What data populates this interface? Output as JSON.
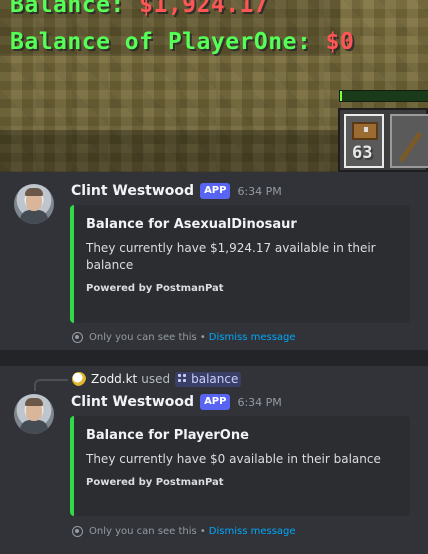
{
  "minecraft": {
    "lines": [
      {
        "label": "Balance: ",
        "amount": "$1,924.17"
      },
      {
        "label": "Balance of PlayerOne: ",
        "amount": "$0"
      }
    ],
    "hotbar": {
      "slot1_count": "63"
    },
    "xp_level_fraction": 0.02,
    "colors": {
      "label": "#55ff55",
      "amount": "#ff5555"
    }
  },
  "messages": [
    {
      "author": "Clint Westwood",
      "badge": "APP",
      "time": "6:34 PM",
      "embed": {
        "title": "Balance for AsexualDinosaur",
        "description": "They currently have $1,924.17 available in their balance",
        "footer": "Powered by PostmanPat",
        "accent": "#32d74b"
      },
      "ephemeral_text": "Only you can see this • ",
      "dismiss_label": "Dismiss message"
    },
    {
      "reply": {
        "user": "Zodd.kt",
        "used": "used",
        "command": "balance"
      },
      "author": "Clint Westwood",
      "badge": "APP",
      "time": "6:34 PM",
      "embed": {
        "title": "Balance for PlayerOne",
        "description": "They currently have $0 available in their balance",
        "footer": "Powered by PostmanPat",
        "accent": "#32d74b"
      },
      "ephemeral_text": "Only you can see this • ",
      "dismiss_label": "Dismiss message"
    }
  ]
}
